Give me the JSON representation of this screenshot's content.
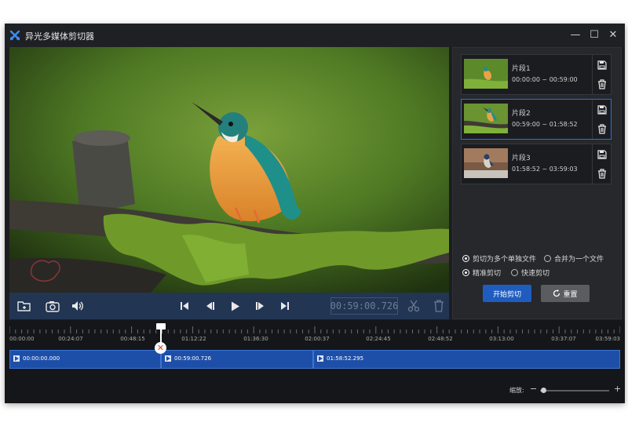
{
  "app": {
    "title": "异光多媒体剪切器"
  },
  "window_controls": {
    "minimize": "—",
    "maximize": "☐",
    "close": "✕"
  },
  "controls": {
    "timecode": "00:59:00.726",
    "icons": [
      "add-file-icon",
      "screenshot-icon",
      "volume-icon",
      "skip-start-icon",
      "prev-frame-icon",
      "play-icon",
      "next-frame-icon",
      "skip-end-icon",
      "scissors-icon",
      "trash-icon"
    ]
  },
  "clips": [
    {
      "name": "片段1",
      "time": "00:00:00 ~ 00:59:00",
      "selected": false
    },
    {
      "name": "片段2",
      "time": "00:59:00 ~ 01:58:52",
      "selected": true
    },
    {
      "name": "片段3",
      "time": "01:58:52 ~ 03:59:03",
      "selected": false
    }
  ],
  "options": {
    "split_multi": "剪切为多个单独文件",
    "merge_one": "合并为一个文件",
    "precise": "精准剪切",
    "fast": "快速剪切",
    "split_selected": true,
    "precise_selected": true
  },
  "buttons": {
    "start": "开始剪切",
    "reset": "重置"
  },
  "timeline": {
    "ticks": [
      "00:00:00",
      "00:24:07",
      "00:48:15",
      "01:12:22",
      "01:36:30",
      "02:00:37",
      "02:24:45",
      "02:48:52",
      "03:13:00",
      "03:37:07",
      "03:59:03"
    ],
    "segments": [
      {
        "label": "00:00:00.000"
      },
      {
        "label": "00:59:00.726"
      },
      {
        "label": "01:58:52.295"
      }
    ],
    "zoom_label": "缩放:",
    "zoom_minus": "−",
    "zoom_plus": "+"
  },
  "colors": {
    "accent": "#1f5cbf",
    "segment": "#1e4fa8",
    "controls_bar": "#223553"
  }
}
